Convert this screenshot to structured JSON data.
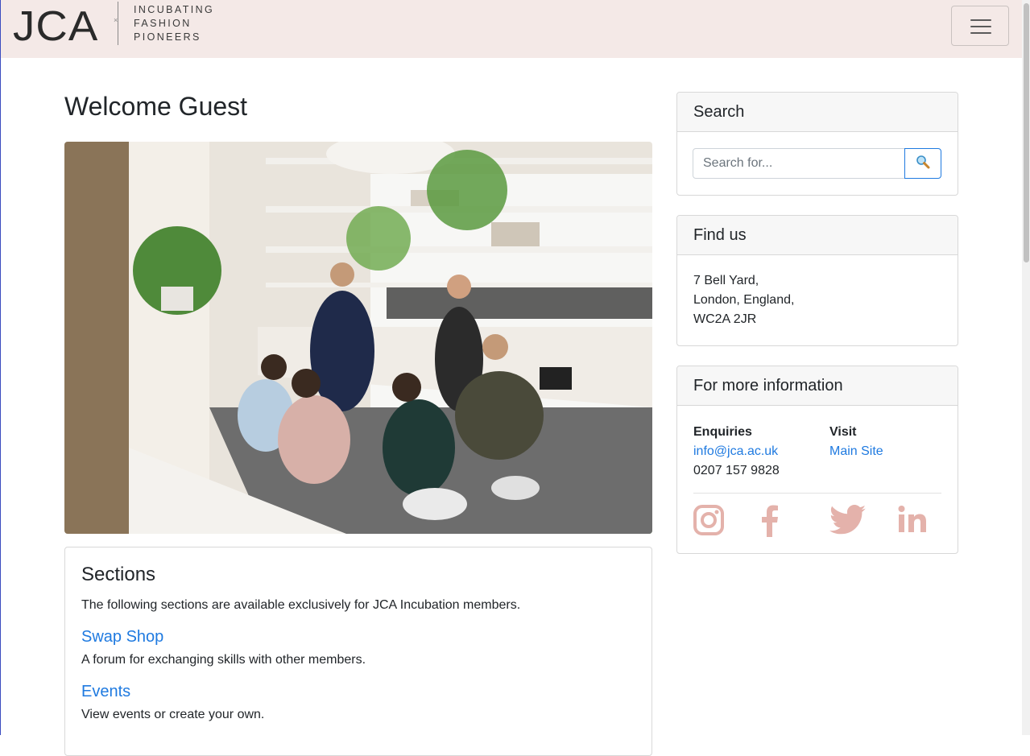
{
  "header": {
    "logo_text": "JCA",
    "tagline": [
      "INCUBATING",
      "FASHION",
      "PIONEERS"
    ],
    "menu_button": "hamburger-icon"
  },
  "main": {
    "title": "Welcome Guest",
    "sections": {
      "title": "Sections",
      "intro": "The following sections are available exclusively for JCA Incubation members.",
      "items": [
        {
          "label": "Swap Shop",
          "description": "A forum for exchanging skills with other members."
        },
        {
          "label": "Events",
          "description": "View events or create your own."
        }
      ]
    }
  },
  "sidebar": {
    "search": {
      "title": "Search",
      "placeholder": "Search for...",
      "button_icon": "search-icon"
    },
    "find_us": {
      "title": "Find us",
      "address": [
        "7 Bell Yard,",
        "London, England,",
        "WC2A 2JR"
      ]
    },
    "more_info": {
      "title": "For more information",
      "enquiries": {
        "label": "Enquiries",
        "email": "info@jca.ac.uk",
        "phone": "0207 157 9828"
      },
      "visit": {
        "label": "Visit",
        "link": "Main Site"
      },
      "social": [
        "instagram-icon",
        "facebook-icon",
        "twitter-icon",
        "linkedin-icon"
      ],
      "social_color": "#e4b2ab"
    }
  },
  "colors": {
    "navbar_bg": "#f4e9e7",
    "link": "#1f7ae0",
    "social": "#e4b2ab"
  }
}
